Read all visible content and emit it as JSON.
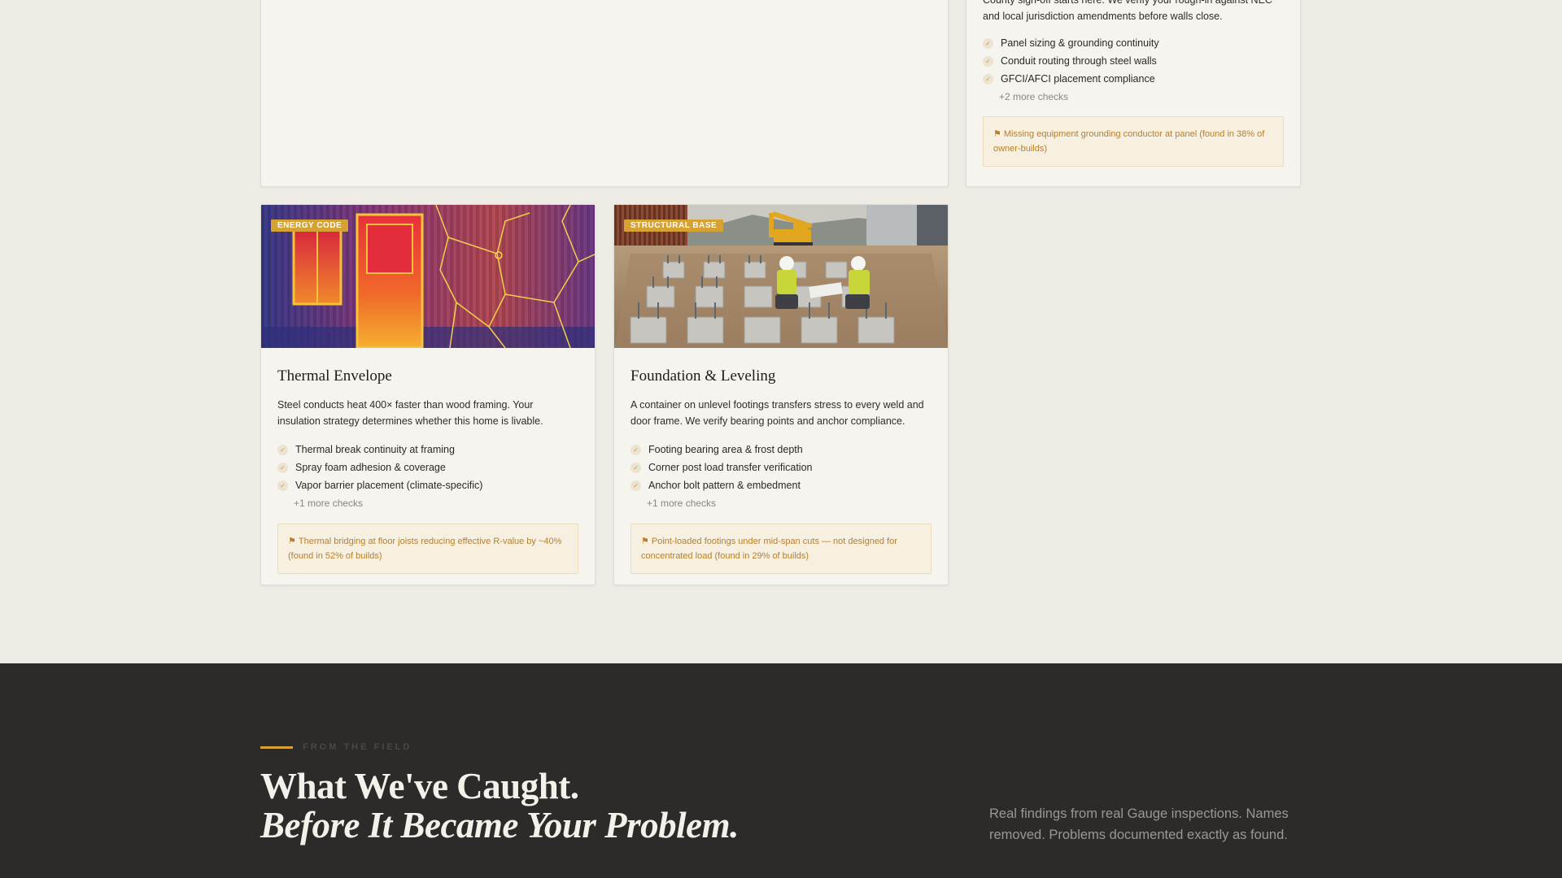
{
  "top_right_card": {
    "desc": "County sign-off starts here. We verify your rough-in against NEC and local jurisdiction amendments before walls close.",
    "checks": [
      "Panel sizing & grounding continuity",
      "Conduit routing through steel walls",
      "GFCI/AFCI placement compliance"
    ],
    "more": "+2 more checks",
    "flag": "Missing equipment grounding conductor at panel (found in 38% of owner-builds)"
  },
  "cards": [
    {
      "badge": "ENERGY CODE",
      "title": "Thermal Envelope",
      "desc": "Steel conducts heat 400× faster than wood framing. Your insulation strategy determines whether this home is livable.",
      "checks": [
        "Thermal break continuity at framing",
        "Spray foam adhesion & coverage",
        "Vapor barrier placement (climate-specific)"
      ],
      "more": "+1 more checks",
      "flag": "Thermal bridging at floor joists reducing effective R-value by ~40% (found in 52% of builds)"
    },
    {
      "badge": "STRUCTURAL BASE",
      "title": "Foundation & Leveling",
      "desc": "A container on unlevel footings transfers stress to every weld and door frame. We verify bearing points and anchor compliance.",
      "checks": [
        "Footing bearing area & frost depth",
        "Corner post load transfer verification",
        "Anchor bolt pattern & embedment"
      ],
      "more": "+1 more checks",
      "flag": "Point-loaded footings under mid-span cuts — not designed for concentrated load (found in 29% of builds)"
    }
  ],
  "field": {
    "eyebrow": "FROM THE FIELD",
    "headline_line1": "What We've Caught.",
    "headline_line2": "Before It Became Your Problem.",
    "lede": "Real findings from real Gauge inspections. Names removed. Problems documented exactly as found."
  },
  "icons": {
    "check": "check-icon",
    "flag": "flag-icon"
  },
  "colors": {
    "accent": "#d6a233",
    "flag_text": "#b7802c",
    "dark_bg": "#2c2b2a",
    "page_bg": "#efece6"
  }
}
